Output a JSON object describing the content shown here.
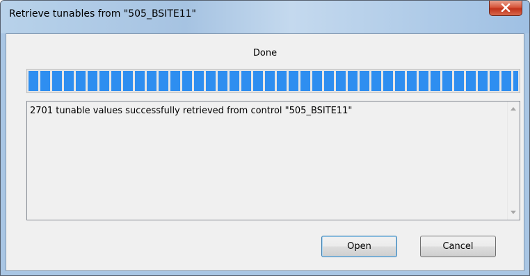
{
  "window": {
    "title": "Retrieve tunables from \"505_BSITE11\""
  },
  "status": {
    "label": "Done",
    "progress_percent": 100
  },
  "log": {
    "message": "2701 tunable values successfully retrieved from control \"505_BSITE11\""
  },
  "buttons": {
    "open_label": "Open",
    "cancel_label": "Cancel"
  },
  "icons": {
    "close": "close-icon",
    "scroll_up": "scroll-up-arrow-icon",
    "scroll_down": "scroll-down-arrow-icon"
  },
  "colors": {
    "progress_fill": "#2e8ef0",
    "close_button": "#c1321a"
  }
}
